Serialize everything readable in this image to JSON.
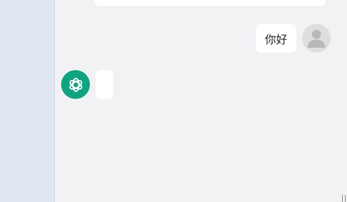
{
  "conversation": {
    "messages": [
      {
        "role": "user",
        "text": "你好"
      },
      {
        "role": "assistant",
        "text": ""
      }
    ]
  },
  "icons": {
    "user_avatar": "person-silhouette-icon",
    "assistant_avatar": "openai-logo-icon",
    "resize": "resize-handle-icon"
  },
  "colors": {
    "background": "#f1f2f4",
    "sidebar": "#dfe5f1",
    "assistant_avatar_bg": "#10a37f",
    "user_avatar_bg": "#dedede",
    "bubble": "#ffffff"
  }
}
